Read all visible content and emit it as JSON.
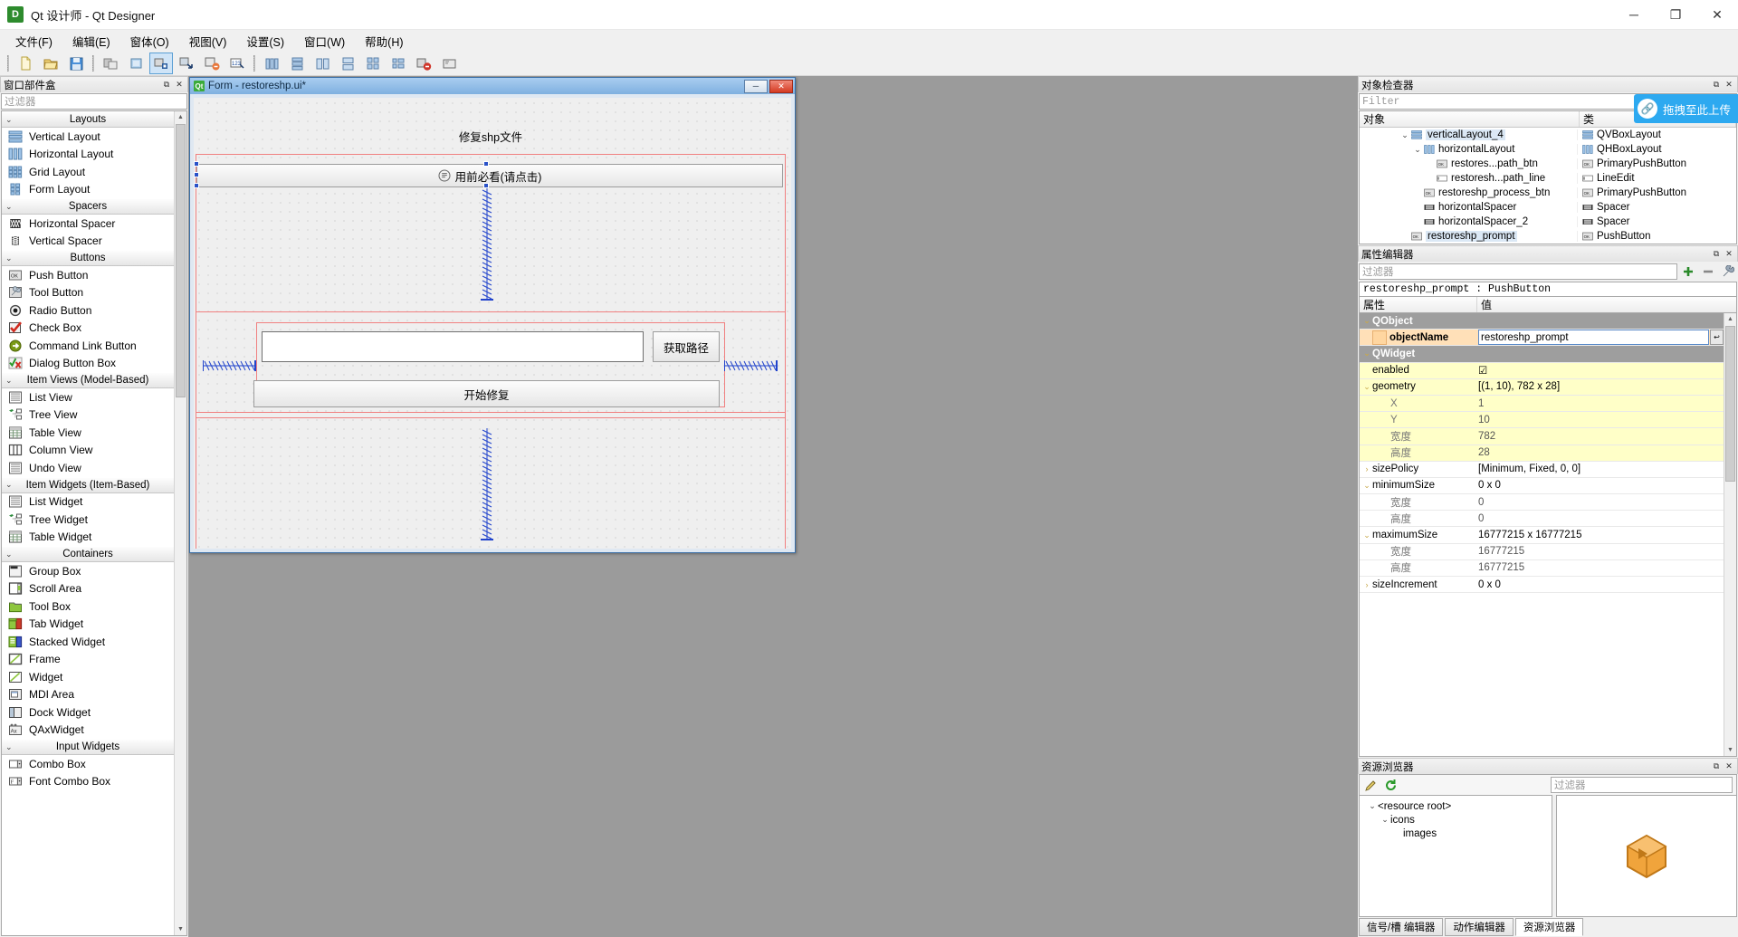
{
  "window": {
    "title": "Qt 设计师 - Qt Designer",
    "app_icon": "qt-designer-icon",
    "minimize": "─",
    "maximize": "❐",
    "close": "✕"
  },
  "menubar": {
    "items": [
      {
        "label": "文件(F)",
        "name": "menu-file"
      },
      {
        "label": "编辑(E)",
        "name": "menu-edit"
      },
      {
        "label": "窗体(O)",
        "name": "menu-form"
      },
      {
        "label": "视图(V)",
        "name": "menu-view"
      },
      {
        "label": "设置(S)",
        "name": "menu-settings"
      },
      {
        "label": "窗口(W)",
        "name": "menu-window"
      },
      {
        "label": "帮助(H)",
        "name": "menu-help"
      }
    ]
  },
  "toolbar": {
    "groups": [
      [
        "new-file-icon",
        "open-file-icon",
        "save-file-icon"
      ],
      [
        "edit-widgets-icon",
        "edit-signals-icon",
        "edit-buddies-icon",
        "edit-tab-order-icon",
        "edit-number-icon"
      ],
      [
        "layout-horizontal-icon",
        "layout-vertical-icon",
        "layout-splitter-h-icon",
        "layout-splitter-v-icon",
        "layout-grid-icon",
        "layout-form-icon",
        "break-layout-icon",
        "adjust-size-icon"
      ]
    ]
  },
  "widget_box": {
    "title": "窗口部件盒",
    "filter_placeholder": "过滤器",
    "float_icon": "undock-icon",
    "close_icon": "close-icon",
    "categories": [
      {
        "label": "Layouts",
        "items": [
          {
            "label": "Vertical Layout",
            "icon": "vertical-layout-icon"
          },
          {
            "label": "Horizontal Layout",
            "icon": "horizontal-layout-icon"
          },
          {
            "label": "Grid Layout",
            "icon": "grid-layout-icon"
          },
          {
            "label": "Form Layout",
            "icon": "form-layout-icon"
          }
        ]
      },
      {
        "label": "Spacers",
        "items": [
          {
            "label": "Horizontal Spacer",
            "icon": "horizontal-spacer-icon"
          },
          {
            "label": "Vertical Spacer",
            "icon": "vertical-spacer-icon"
          }
        ]
      },
      {
        "label": "Buttons",
        "items": [
          {
            "label": "Push Button",
            "icon": "push-button-icon"
          },
          {
            "label": "Tool Button",
            "icon": "tool-button-icon"
          },
          {
            "label": "Radio Button",
            "icon": "radio-button-icon"
          },
          {
            "label": "Check Box",
            "icon": "check-box-icon"
          },
          {
            "label": "Command Link Button",
            "icon": "command-link-icon"
          },
          {
            "label": "Dialog Button Box",
            "icon": "dialog-button-box-icon"
          }
        ]
      },
      {
        "label": "Item Views (Model-Based)",
        "items": [
          {
            "label": "List View",
            "icon": "list-view-icon"
          },
          {
            "label": "Tree View",
            "icon": "tree-view-icon"
          },
          {
            "label": "Table View",
            "icon": "table-view-icon"
          },
          {
            "label": "Column View",
            "icon": "column-view-icon"
          },
          {
            "label": "Undo View",
            "icon": "undo-view-icon"
          }
        ]
      },
      {
        "label": "Item Widgets (Item-Based)",
        "items": [
          {
            "label": "List Widget",
            "icon": "list-widget-icon"
          },
          {
            "label": "Tree Widget",
            "icon": "tree-widget-icon"
          },
          {
            "label": "Table Widget",
            "icon": "table-widget-icon"
          }
        ]
      },
      {
        "label": "Containers",
        "items": [
          {
            "label": "Group Box",
            "icon": "group-box-icon"
          },
          {
            "label": "Scroll Area",
            "icon": "scroll-area-icon"
          },
          {
            "label": "Tool Box",
            "icon": "tool-box-icon"
          },
          {
            "label": "Tab Widget",
            "icon": "tab-widget-icon"
          },
          {
            "label": "Stacked Widget",
            "icon": "stacked-widget-icon"
          },
          {
            "label": "Frame",
            "icon": "frame-icon"
          },
          {
            "label": "Widget",
            "icon": "widget-icon"
          },
          {
            "label": "MDI Area",
            "icon": "mdi-area-icon"
          },
          {
            "label": "Dock Widget",
            "icon": "dock-widget-icon"
          },
          {
            "label": "QAxWidget",
            "icon": "qax-widget-icon"
          }
        ]
      },
      {
        "label": "Input Widgets",
        "items": [
          {
            "label": "Combo Box",
            "icon": "combo-box-icon"
          },
          {
            "label": "Font Combo Box",
            "icon": "font-combo-box-icon"
          }
        ]
      }
    ]
  },
  "form": {
    "title": "Form - restoreshp.ui*",
    "icon": "qt-icon",
    "minimize": "─",
    "close": "✕",
    "heading": "修复shp文件",
    "prompt_button": "用前必看(请点击)",
    "prompt_icon": "document-icon",
    "path_input_value": "",
    "get_path_button": "获取路径",
    "process_button": "开始修复"
  },
  "object_inspector": {
    "title": "对象检查器",
    "filter_placeholder": "Filter",
    "columns": [
      "对象",
      "类"
    ],
    "rows": [
      {
        "name": "verticalLayout_4",
        "class": "QVBoxLayout",
        "depth": 3,
        "expanded": true,
        "icon": "vbox-layout-icon",
        "selected": true
      },
      {
        "name": "horizontalLayout",
        "class": "QHBoxLayout",
        "depth": 4,
        "expanded": true,
        "icon": "hbox-layout-icon",
        "selected": false
      },
      {
        "name": "restores...path_btn",
        "class": "PrimaryPushButton",
        "depth": 5,
        "expanded": false,
        "icon": "push-button-icon",
        "selected": false
      },
      {
        "name": "restoresh...path_line",
        "class": "LineEdit",
        "depth": 5,
        "expanded": false,
        "icon": "line-edit-icon",
        "selected": false
      },
      {
        "name": "restoreshp_process_btn",
        "class": "PrimaryPushButton",
        "depth": 4,
        "expanded": false,
        "icon": "push-button-icon",
        "selected": false
      },
      {
        "name": "horizontalSpacer",
        "class": "Spacer",
        "depth": 4,
        "expanded": false,
        "icon": "spacer-icon",
        "selected": false
      },
      {
        "name": "horizontalSpacer_2",
        "class": "Spacer",
        "depth": 4,
        "expanded": false,
        "icon": "spacer-icon",
        "selected": false
      },
      {
        "name": "restoreshp_prompt",
        "class": "PushButton",
        "depth": 3,
        "expanded": false,
        "icon": "push-button-icon",
        "selected": true
      }
    ]
  },
  "property_editor": {
    "title": "属性编辑器",
    "filter_placeholder": "过滤器",
    "add_icon": "add-icon",
    "remove_icon": "remove-icon",
    "config_icon": "wrench-icon",
    "object_line": "restoreshp_prompt : PushButton",
    "columns": [
      "属性",
      "值"
    ],
    "rows": [
      {
        "kind": "group",
        "name": "QObject",
        "value": "",
        "expanded": true
      },
      {
        "kind": "prop",
        "name": "objectName",
        "value": "restoreshp_prompt",
        "style": "ora",
        "bold": true,
        "editing": true
      },
      {
        "kind": "group",
        "name": "QWidget",
        "value": "",
        "expanded": true
      },
      {
        "kind": "prop",
        "name": "enabled",
        "value": "☑",
        "style": "yel"
      },
      {
        "kind": "prop",
        "name": "geometry",
        "value": "[(1, 10), 782 x 28]",
        "style": "yel",
        "expanded": true
      },
      {
        "kind": "sub",
        "name": "X",
        "value": "1",
        "style": "yel"
      },
      {
        "kind": "sub",
        "name": "Y",
        "value": "10",
        "style": "yel"
      },
      {
        "kind": "sub",
        "name": "宽度",
        "value": "782",
        "style": "yel"
      },
      {
        "kind": "sub",
        "name": "高度",
        "value": "28",
        "style": "yel"
      },
      {
        "kind": "prop",
        "name": "sizePolicy",
        "value": "[Minimum, Fixed, 0, 0]",
        "style": "whi",
        "collapsed": true
      },
      {
        "kind": "prop",
        "name": "minimumSize",
        "value": "0 x 0",
        "style": "whi",
        "expanded": true
      },
      {
        "kind": "sub",
        "name": "宽度",
        "value": "0",
        "style": "whi"
      },
      {
        "kind": "sub",
        "name": "高度",
        "value": "0",
        "style": "whi"
      },
      {
        "kind": "prop",
        "name": "maximumSize",
        "value": "16777215 x 16777215",
        "style": "whi",
        "expanded": true
      },
      {
        "kind": "sub",
        "name": "宽度",
        "value": "16777215",
        "style": "whi"
      },
      {
        "kind": "sub",
        "name": "高度",
        "value": "16777215",
        "style": "whi"
      },
      {
        "kind": "prop",
        "name": "sizeIncrement",
        "value": "0 x 0",
        "style": "whi",
        "collapsed": true
      }
    ]
  },
  "resource_browser": {
    "title": "资源浏览器",
    "edit_icon": "pencil-icon",
    "reload_icon": "reload-icon",
    "filter_placeholder": "过滤器",
    "tree": [
      {
        "label": "<resource root>",
        "depth": 0,
        "expanded": true
      },
      {
        "label": "icons",
        "depth": 1,
        "expanded": true
      },
      {
        "label": "images",
        "depth": 2,
        "expanded": false
      }
    ],
    "preview_icon": "orange-cube-icon",
    "tabs": [
      {
        "label": "信号/槽 编辑器",
        "active": false
      },
      {
        "label": "动作编辑器",
        "active": false
      },
      {
        "label": "资源浏览器",
        "active": true
      }
    ]
  },
  "upload_badge": {
    "label": "拖拽至此上传",
    "icon": "link-icon",
    "color": "#2da9f0"
  }
}
